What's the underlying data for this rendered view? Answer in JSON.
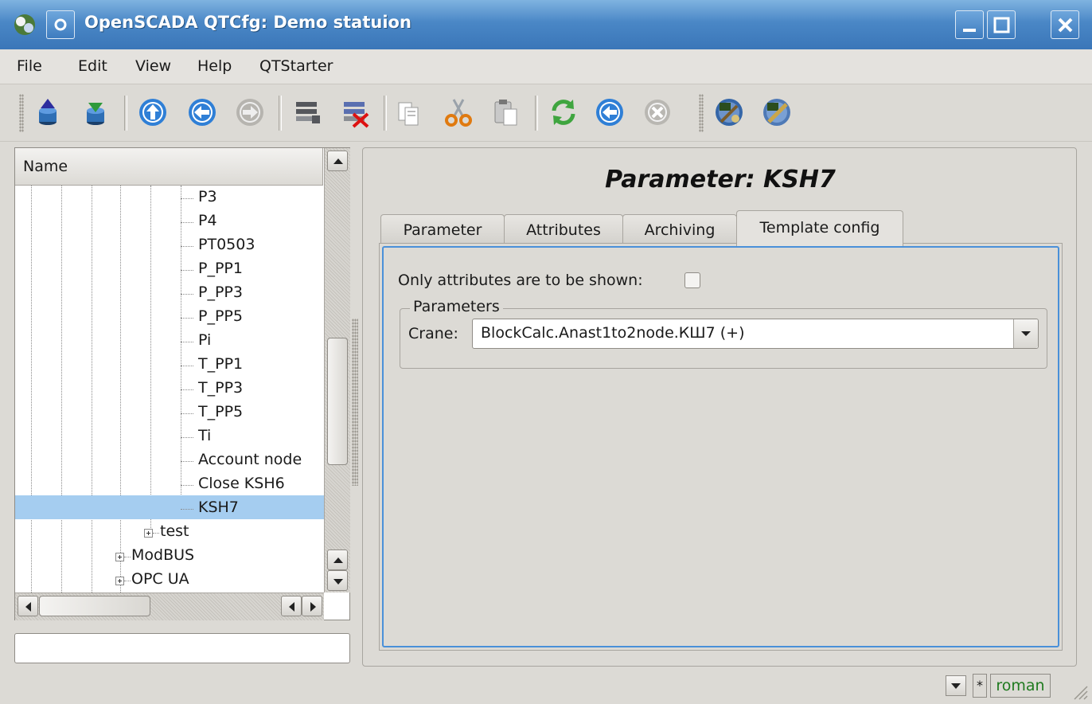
{
  "window": {
    "title": "OpenSCADA QTCfg: Demo statuion",
    "accent": "#4a87c6"
  },
  "menu": [
    "File",
    "Edit",
    "View",
    "Help",
    "QTStarter"
  ],
  "toolbar": {
    "icons": [
      "db-load-icon",
      "db-save-icon",
      "up-icon",
      "back-icon",
      "forward-icon",
      "item-add-icon",
      "item-delete-icon",
      "copy-icon",
      "cut-icon",
      "paste-icon",
      "refresh-icon",
      "start-icon",
      "stop-icon",
      "qtstarter-icon",
      "config-icon"
    ]
  },
  "tree": {
    "header": "Name",
    "items": [
      {
        "label": "P3"
      },
      {
        "label": "P4"
      },
      {
        "label": "PT0503"
      },
      {
        "label": "P_PP1"
      },
      {
        "label": "P_PP3"
      },
      {
        "label": "P_PP5"
      },
      {
        "label": "Pi"
      },
      {
        "label": "T_PP1"
      },
      {
        "label": "T_PP3"
      },
      {
        "label": "T_PP5"
      },
      {
        "label": "Ti"
      },
      {
        "label": "Account node"
      },
      {
        "label": "Close KSH6"
      },
      {
        "label": "KSH7",
        "selected": true
      }
    ],
    "groups": [
      {
        "label": "test"
      },
      {
        "label": "ModBUS"
      },
      {
        "label": "OPC UA"
      }
    ],
    "selection_color": "#a5cdf0"
  },
  "status_input": {
    "value": ""
  },
  "page": {
    "title": "Parameter: KSH7",
    "tabs": [
      {
        "label": "Parameter"
      },
      {
        "label": "Attributes"
      },
      {
        "label": "Archiving"
      },
      {
        "label": "Template config",
        "active": true
      }
    ],
    "only_attrs_label": "Only attributes are to be shown:",
    "only_attrs_checked": false,
    "group_title": "Parameters",
    "crane_label": "Crane:",
    "crane_value": "BlockCalc.Anast1to2node.КШ7 (+)"
  },
  "statusbar": {
    "star": "*",
    "user": "roman",
    "user_color": "#1f7a1f"
  }
}
